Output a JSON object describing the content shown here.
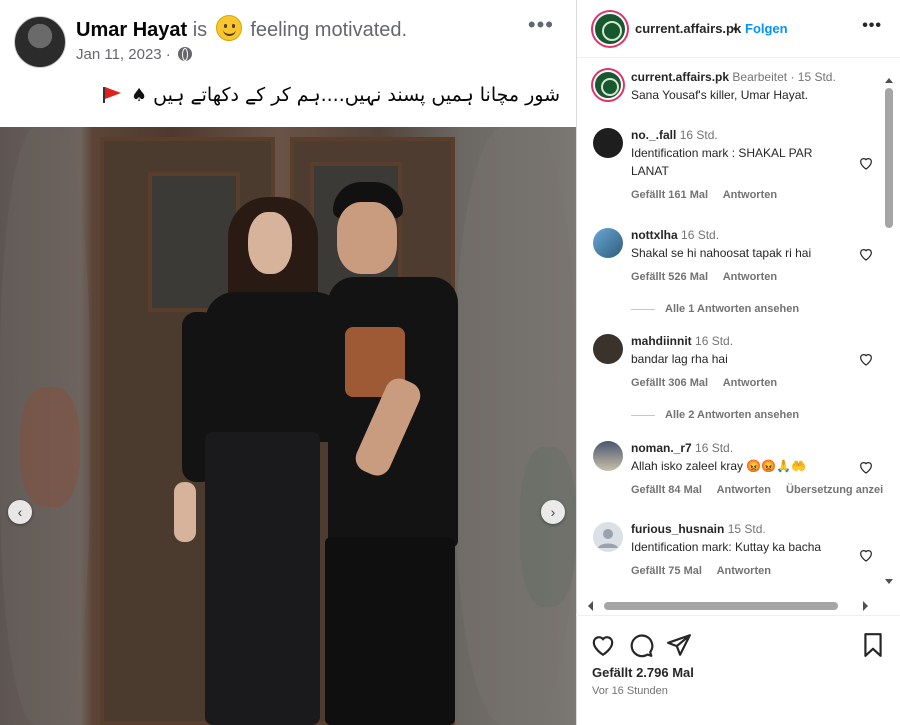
{
  "facebook": {
    "author": "Umar Hayat",
    "is_word": "is",
    "feeling": "feeling motivated.",
    "date": "Jan 11, 2023 ·",
    "more_label": "•••",
    "caption": "شور مچانا ہمیں پسند نہیں....ہم کر کے دکھاتے ہیں",
    "caption_spade": "♠",
    "prev_label": "‹",
    "next_label": "›"
  },
  "instagram": {
    "account": "current.affairs.pk",
    "dot": "•",
    "follow": "Folgen",
    "more_label": "•••",
    "caption": {
      "user": "current.affairs.pk",
      "edited": "Bearbeitet",
      "time": "· 15 Std.",
      "text": "Sana Yousaf's killer, Umar Hayat."
    },
    "comments": [
      {
        "user": "no._.fall",
        "time": "16 Std.",
        "text": "Identification mark : SHAKAL PAR LANAT",
        "likes": "Gefällt 161 Mal",
        "reply": "Antworten",
        "extra": ""
      },
      {
        "user": "nottxlha",
        "time": "16 Std.",
        "text": "Shakal se hi nahoosat tapak ri hai",
        "likes": "Gefällt 526 Mal",
        "reply": "Antworten",
        "extra": "",
        "replies": "Alle 1 Antworten ansehen"
      },
      {
        "user": "mahdiinnit",
        "time": "16 Std.",
        "text": "bandar lag rha hai",
        "likes": "Gefällt 306 Mal",
        "reply": "Antworten",
        "extra": "",
        "replies": "Alle 2 Antworten ansehen"
      },
      {
        "user": "noman._r7",
        "time": "16 Std.",
        "text": "Allah isko zaleel kray 😡😡🙏🤲",
        "likes": "Gefällt 84 Mal",
        "reply": "Antworten",
        "extra": "Übersetzung anzei"
      },
      {
        "user": "furious_husnain",
        "time": "15 Std.",
        "text": "Identification mark: Kuttay ka bacha",
        "likes": "Gefällt 75 Mal",
        "reply": "Antworten",
        "extra": ""
      }
    ],
    "likes_total": "Gefällt 2.796 Mal",
    "posted_ago": "Vor 16 Stunden"
  }
}
